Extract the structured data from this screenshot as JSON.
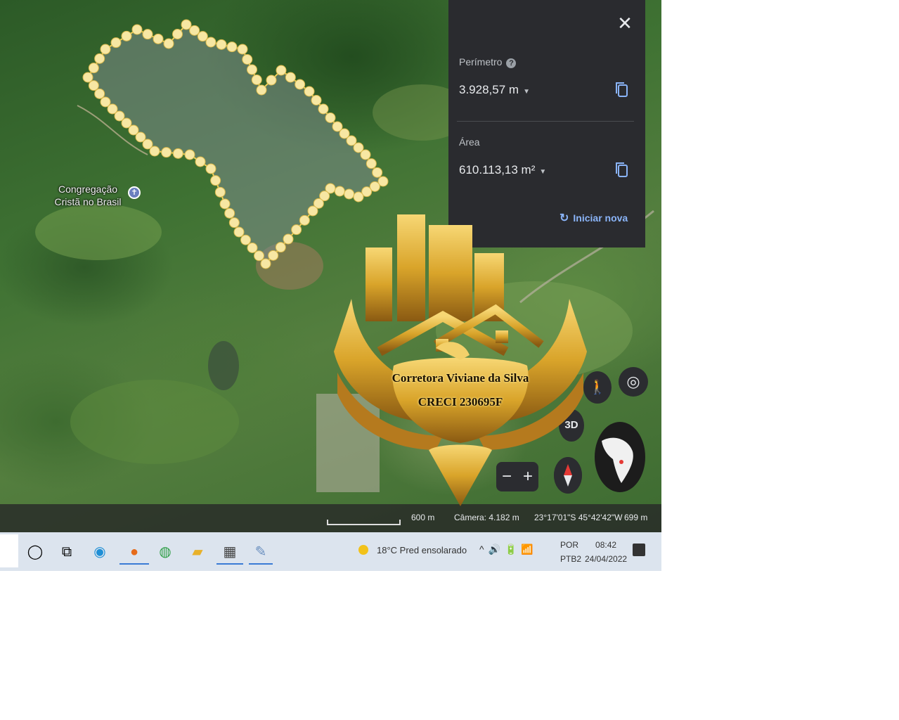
{
  "map": {
    "place_label": "Congregação Cristã no Brasil",
    "place_icon": "church-pin-icon"
  },
  "measure_panel": {
    "close_icon": "close-icon",
    "perimeter_label": "Perímetro",
    "perimeter_value": "3.928,57 m",
    "area_label": "Área",
    "area_value": "610.113,13 m²",
    "restart_label": "Iniciar nova",
    "copy_icon": "copy-icon",
    "help_icon": "help-icon"
  },
  "controls": {
    "pegman_icon": "pegman-icon",
    "locate_icon": "my-location-icon",
    "three_d_label": "3D",
    "zoom_out": "−",
    "zoom_in": "+",
    "compass_icon": "compass-icon",
    "globe_icon": "globe-icon"
  },
  "status_bar": {
    "scale_text": "600 m",
    "camera": "Câmera: 4.182 m",
    "coordinates": "23°17'01\"S 45°42'42\"W",
    "altitude": "699 m"
  },
  "taskbar": {
    "weather": "18°C  Pred ensolarado",
    "lang_line1": "POR",
    "lang_line2": "PTB2",
    "time": "08:42",
    "date": "24/04/2022",
    "apps": [
      "cortana-icon",
      "task-view-icon",
      "edge-icon",
      "firefox-icon",
      "chrome-icon",
      "file-explorer-icon",
      "calculator-icon",
      "notepad-icon"
    ]
  },
  "watermark": {
    "line1": "Corretora Viviane da Silva",
    "line2": "CRECI 230695F"
  },
  "colors": {
    "panel_bg": "#2a2b2f",
    "accent_blue": "#8ab4f8",
    "polygon_dot": "#f7e7a3",
    "logo_gold": "#d9a42a"
  }
}
